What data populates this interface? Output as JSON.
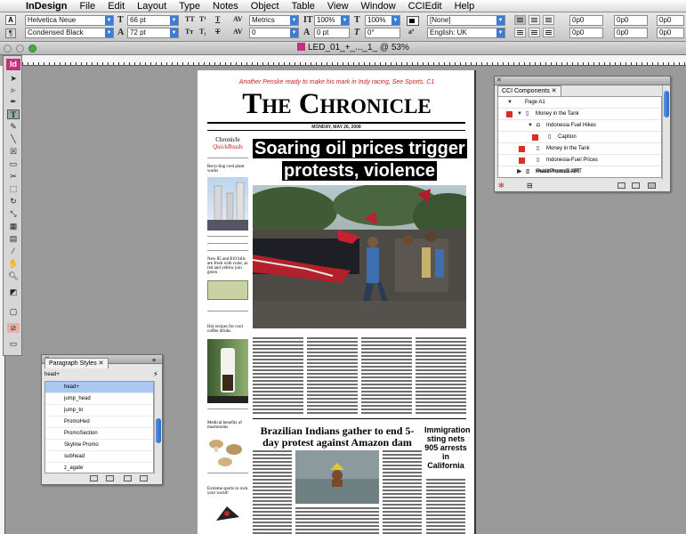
{
  "menubar": {
    "apple": "",
    "app_name": "InDesign",
    "items": [
      "File",
      "Edit",
      "Layout",
      "Type",
      "Notes",
      "Object",
      "Table",
      "View",
      "Window",
      "CCIEdit",
      "Help"
    ]
  },
  "control": {
    "font_family": "Helvetica Neue",
    "font_style": "Condensed Black",
    "font_size": "66 pt",
    "leading": "72 pt",
    "kerning": "Metrics",
    "tracking": "0",
    "vertical_scale": "100%",
    "horizontal_scale": "100%",
    "baseline_shift": "0 pt",
    "skew": "0°",
    "char_style": "[None]",
    "language": "English: UK",
    "indent_left": "0p0",
    "indent_first": "0p0",
    "indent_right": "0p0",
    "space_before": "0p0",
    "space_after": "0p0",
    "last_indent": "0p0"
  },
  "document": {
    "tab_title": "LED_01_+_..._1_ @ 53%"
  },
  "page": {
    "kicker": "Another Penske ready to make his mark in Indy racing, See Sports, C1",
    "masthead": "The Chronicle",
    "dateline": "MONDAY, MAY 26, 2008",
    "quickreads_a": "Chronicle",
    "quickreads_b": "QuickReads",
    "left_items": [
      "Recycling cool plant works",
      "New $5 and $10 bills are fresh with color, as red and yellow join green",
      "Hot recipes for cool coffee drinks",
      "Medical benefits of mushrooms",
      "Extreme sports to rock your world!"
    ],
    "main_headline": "Soaring oil prices trigger protests, violence",
    "sub_headline": "Brazilian Indians gather to end 5-day protest against Amazon dam",
    "side_story": "Immigration sting nets 905 arrests in California"
  },
  "cci_panel": {
    "tab_label": "CCI Components",
    "rows": [
      {
        "label": "Page A1",
        "level": 0,
        "flag": false,
        "expanded": true
      },
      {
        "label": "Money in the Tank",
        "level": 1,
        "flag": true,
        "expanded": true
      },
      {
        "label": "Indonesia Fuel Hikes",
        "level": 2,
        "flag": false,
        "expanded": true
      },
      {
        "label": "Caption",
        "level": 3,
        "flag": true,
        "expanded": false
      },
      {
        "label": "Money in the Tank",
        "level": 2,
        "flag": true,
        "expanded": false
      },
      {
        "label": "Indonesia-Fuel Prices",
        "level": 2,
        "flag": true,
        "expanded": false
      },
      {
        "label": "PulsePromo3.ART",
        "level": 1,
        "flag": false,
        "expanded": false
      },
      {
        "label": "HealthPromo3.ART",
        "level": 1,
        "flag": false,
        "expanded": false
      }
    ]
  },
  "para_panel": {
    "tab_label": "Paragraph Styles",
    "current": "head+",
    "styles": [
      "head+",
      "jump_head",
      "jump_to",
      "PromoHed",
      "PromoSection",
      "Skyline Promo",
      "subhead",
      "z_agate"
    ],
    "selected_index": 0
  }
}
